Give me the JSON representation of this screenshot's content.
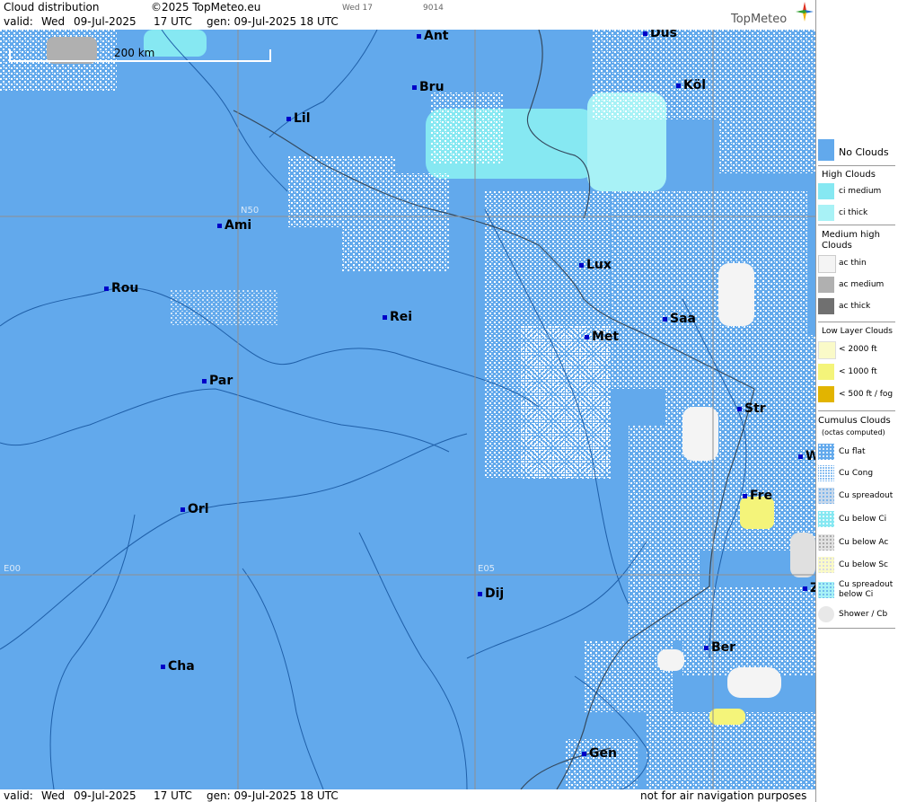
{
  "header": {
    "title": "Cloud distribution",
    "copyright": "©2025 TopMeteo.eu",
    "valid_label": "valid:",
    "valid_day": "Wed",
    "valid_date": "09-Jul-2025",
    "valid_time": "17 UTC",
    "gen_label": "gen: 09-Jul-2025 18 UTC",
    "tiny_run": "Wed 17",
    "tiny_code": "9014",
    "logo": "TopMeteo"
  },
  "map": {
    "scale_label": "200 km",
    "grid_labels": {
      "n50": "N50",
      "e00": "E00",
      "e05": "E05"
    },
    "cities": [
      {
        "name": "Ant"
      },
      {
        "name": "Düs"
      },
      {
        "name": "Bru"
      },
      {
        "name": "Köl"
      },
      {
        "name": "Lil"
      },
      {
        "name": "Ami"
      },
      {
        "name": "Lux"
      },
      {
        "name": "Rou"
      },
      {
        "name": "Rei"
      },
      {
        "name": "Saa"
      },
      {
        "name": "Met"
      },
      {
        "name": "Par"
      },
      {
        "name": "Str"
      },
      {
        "name": "W"
      },
      {
        "name": "Fre"
      },
      {
        "name": "Orl"
      },
      {
        "name": "Dij"
      },
      {
        "name": "Z"
      },
      {
        "name": "Ber"
      },
      {
        "name": "Cha"
      },
      {
        "name": "Gen"
      }
    ]
  },
  "footer": {
    "valid_label": "valid:",
    "valid_day": "Wed",
    "valid_date": "09-Jul-2025",
    "valid_time": "17 UTC",
    "gen_label": "gen: 09-Jul-2025 18 UTC",
    "disclaimer": "not for air navigation purposes"
  },
  "legend": {
    "no_clouds": "No Clouds",
    "high_head": "High Clouds",
    "ci_medium": "ci medium",
    "ci_thick": "ci thick",
    "medium_head_1": "Medium high",
    "medium_head_2": "Clouds",
    "ac_thin": "ac thin",
    "ac_medium": "ac medium",
    "ac_thick": "ac thick",
    "low_head": "Low Layer Clouds",
    "low_2000": "< 2000 ft",
    "low_1000": "< 1000 ft",
    "low_500": "< 500 ft / fog",
    "cu_head_1": "Cumulus Clouds",
    "cu_head_2": "(octas computed)",
    "cu_flat": "Cu flat",
    "cu_cong": "Cu Cong",
    "cu_spread": "Cu spreadout",
    "cu_below_ci": "Cu below Ci",
    "cu_below_ac": "Cu below Ac",
    "cu_below_sc": "Cu below Sc",
    "cu_spread_ci_1": "Cu spreadout",
    "cu_spread_ci_2": "below Ci",
    "shower": "Shower / Cb"
  },
  "colors": {
    "no_clouds": "#62a9ec",
    "ci_medium": "#86e8f2",
    "ci_thick": "#a8f2f6",
    "ac_thin": "#f4f4f4",
    "ac_medium": "#b0b0b0",
    "ac_thick": "#707070",
    "low_2000": "#fafac8",
    "low_1000": "#f4f47a",
    "low_500": "#e2b400",
    "city_dot": "#0000c8"
  }
}
